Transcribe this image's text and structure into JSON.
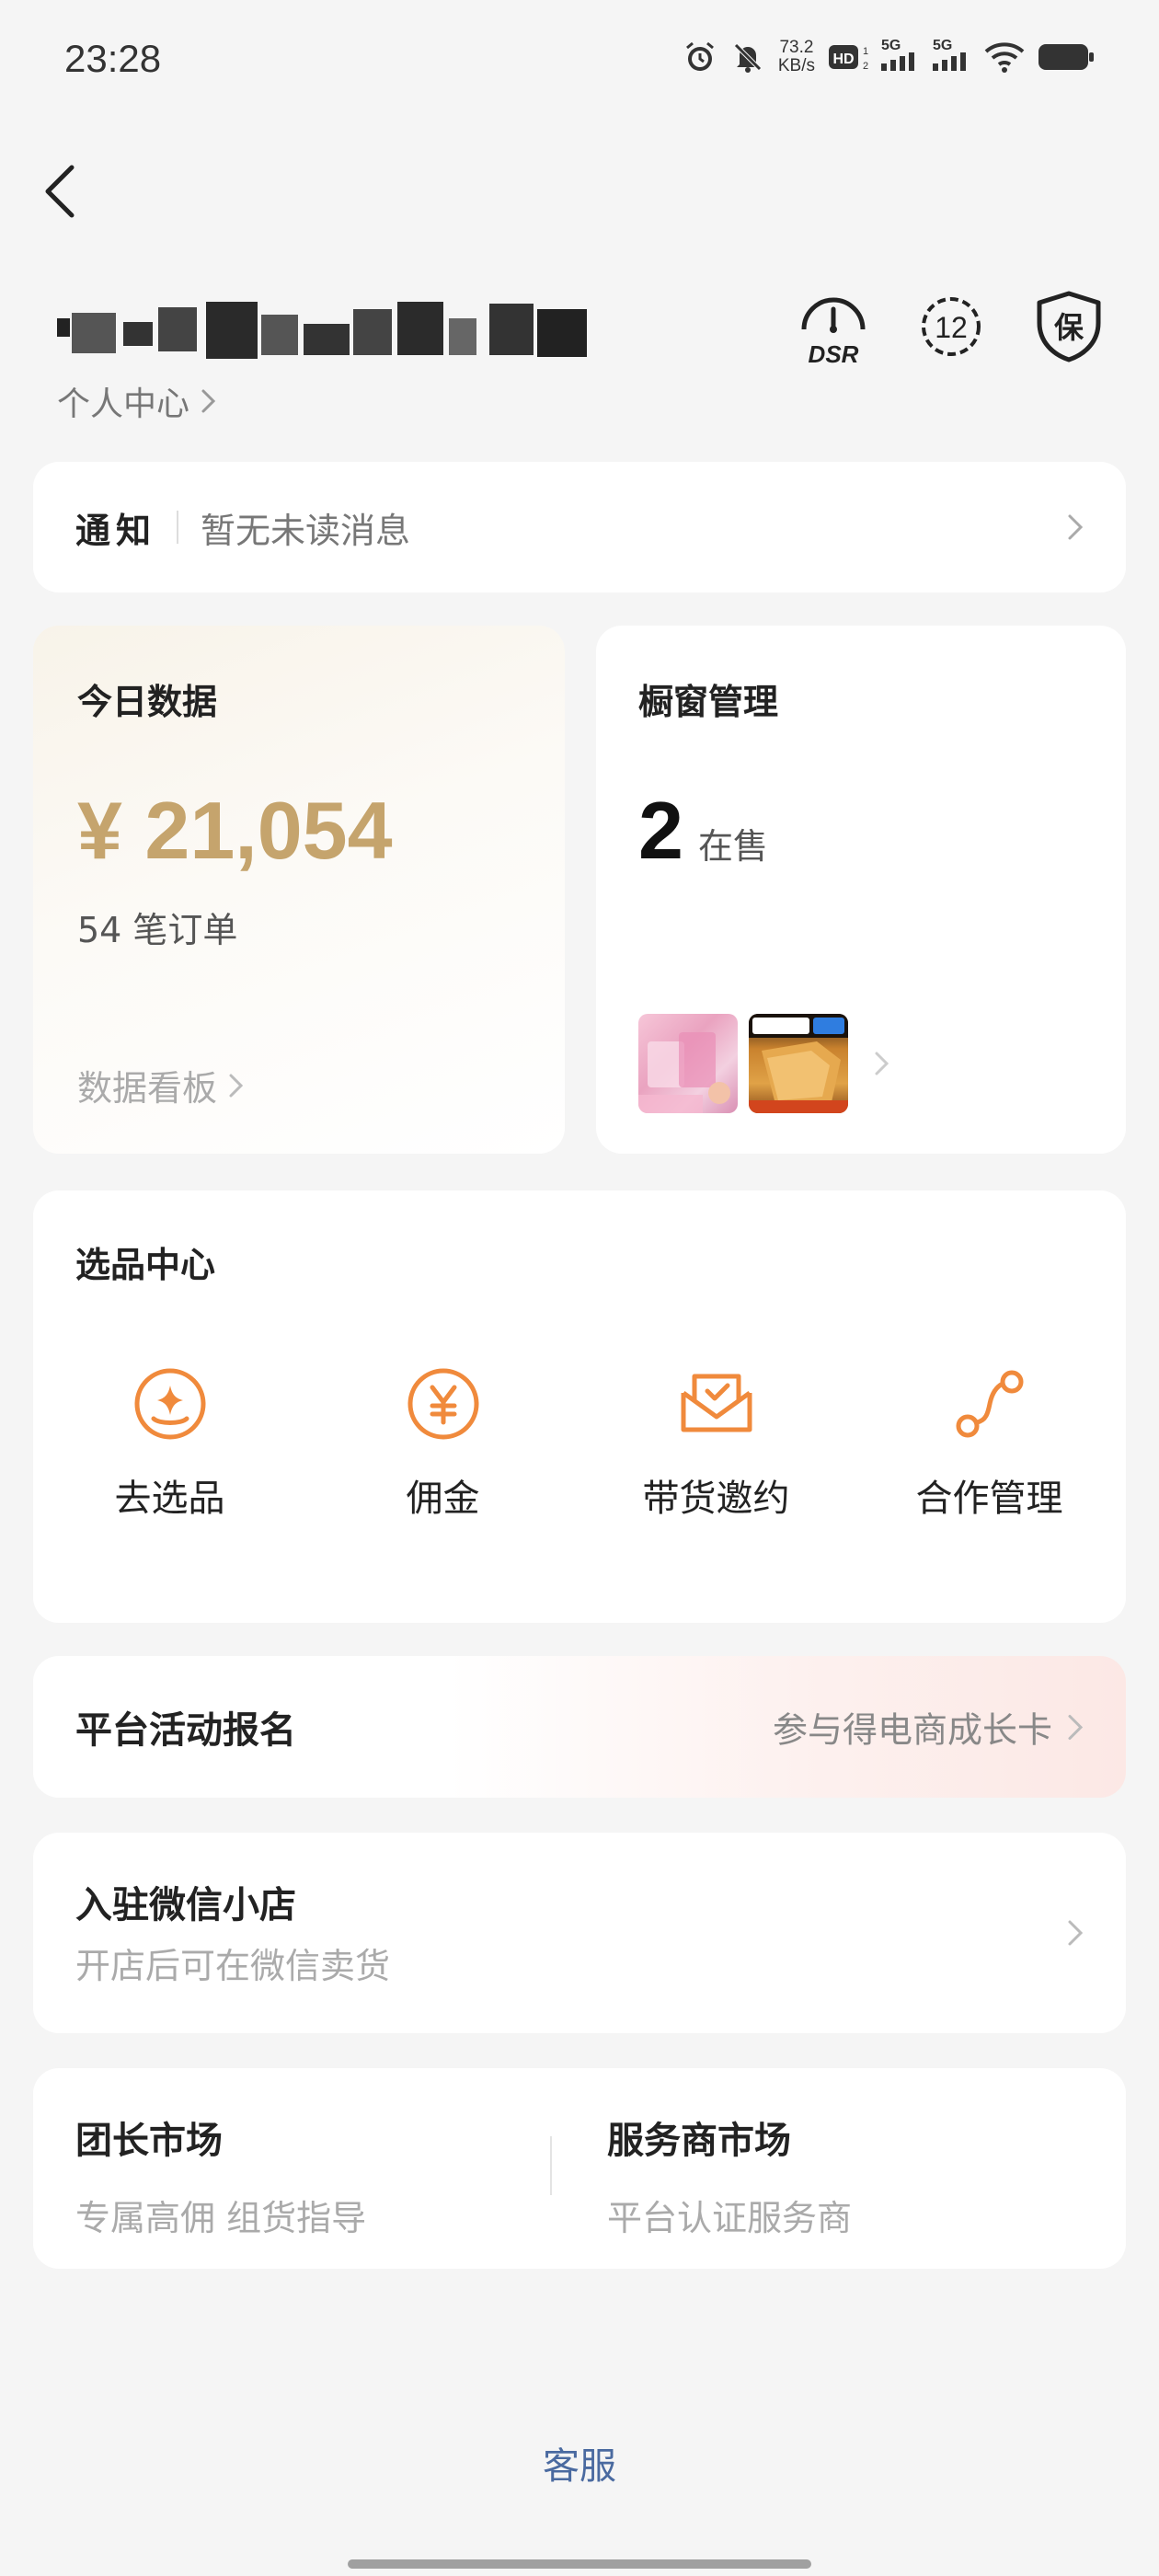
{
  "status_bar": {
    "time": "23:28",
    "net_speed_value": "73.2",
    "net_speed_unit": "KB/s",
    "hd_label": "HD",
    "sim1_label": "5G",
    "sim2_label": "5G"
  },
  "header": {
    "personal_center": "个人中心",
    "dsr_label": "DSR",
    "level_badge": "12",
    "shield_label": "保"
  },
  "notice": {
    "title": "通知",
    "message": "暂无未读消息"
  },
  "today": {
    "title": "今日数据",
    "amount": "¥ 21,054",
    "orders": "54 笔订单",
    "dashboard_link": "数据看板"
  },
  "window": {
    "title": "橱窗管理",
    "count": "2",
    "status": "在售"
  },
  "select_center": {
    "title": "选品中心",
    "items": [
      {
        "label": "去选品",
        "icon": "sparkle-icon"
      },
      {
        "label": "佣金",
        "icon": "yen-icon"
      },
      {
        "label": "带货邀约",
        "icon": "invitation-envelope-icon"
      },
      {
        "label": "合作管理",
        "icon": "route-icon"
      }
    ]
  },
  "activity": {
    "title": "平台活动报名",
    "link": "参与得电商成长卡"
  },
  "wechat_store": {
    "title": "入驻微信小店",
    "subtitle": "开店后可在微信卖货"
  },
  "markets": {
    "leader": {
      "title": "团长市场",
      "subtitle": "专属高佣 组货指导"
    },
    "provider": {
      "title": "服务商市场",
      "subtitle": "平台认证服务商"
    }
  },
  "footer": {
    "service": "客服"
  },
  "colors": {
    "accent_gold": "#c5a46d",
    "icon_orange": "#f08a3c",
    "link_blue": "#4a6aa0"
  }
}
